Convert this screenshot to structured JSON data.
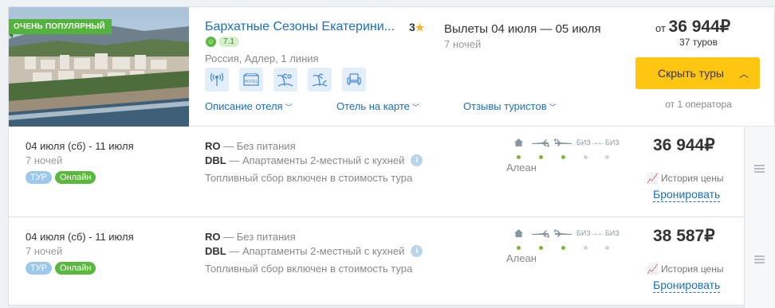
{
  "hotel": {
    "badge": "ОЧЕНЬ ПОПУЛЯРНЫЙ",
    "name": "Бархатные Сезоны Екатерини...",
    "stars": "3",
    "rating": "7.1",
    "location": "Россия, Адлер, 1 линия",
    "amenities": [
      "wifi-icon",
      "hotel-icon",
      "beach-icon",
      "beach-palm-icon",
      "armchair-icon"
    ],
    "links": {
      "description": "Описание отеля",
      "map": "Отель на карте",
      "reviews": "Отзывы туристов"
    }
  },
  "summary": {
    "flights": "Вылеты 04 июля — 05 июля",
    "nights": "7 ночей",
    "from_label": "от",
    "price": "36 944₽",
    "tours_count": "37 туров",
    "hide_button": "Скрыть туры",
    "operators": "от 1 оператора"
  },
  "offers": [
    {
      "dates": "04 июля (сб) - 11 июля",
      "nights": "7 ночей",
      "tag_tour": "ТУР",
      "tag_online": "Онлайн",
      "meal_code": "RO",
      "meal_text": "— Без питания",
      "room_code": "DBL",
      "room_text": "— Апартаменты 2-местный с кухней",
      "fuel": "Топливный сбор включен в стоимость тура",
      "operator": "Алеан",
      "price": "36 944₽",
      "history": "История цены",
      "book": "Бронировать"
    },
    {
      "dates": "04 июля (сб) - 11 июля",
      "nights": "7 ночей",
      "tag_tour": "ТУР",
      "tag_online": "Онлайн",
      "meal_code": "RO",
      "meal_text": "— Без питания",
      "room_code": "DBL",
      "room_text": "— Апартаменты 2-местный с кухней",
      "fuel": "Топливный сбор включен в стоимость тура",
      "operator": "Алеан",
      "price": "38 587₽",
      "history": "История цены",
      "book": "Бронировать"
    }
  ],
  "service_labels": {
    "biz1": "БИЗ",
    "biz2": "БИЗ"
  },
  "colors": {
    "accent": "#1a6ec4",
    "button": "#ffc611",
    "green": "#5ab83c"
  }
}
